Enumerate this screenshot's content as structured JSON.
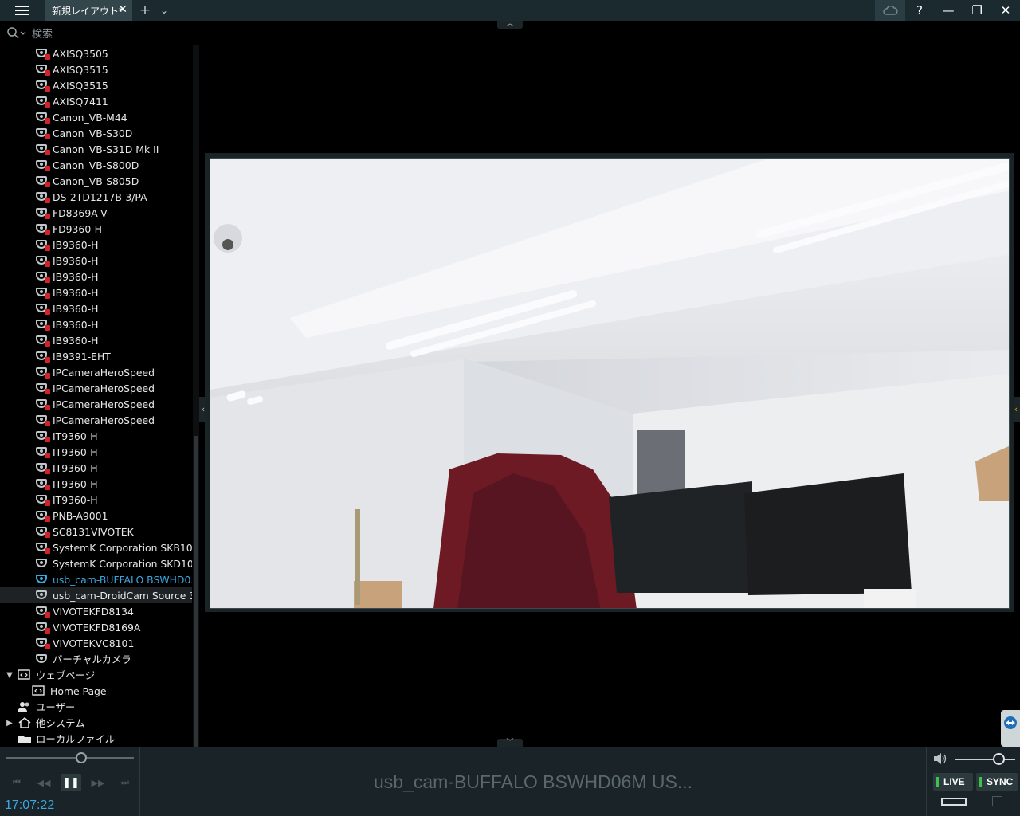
{
  "titlebar": {
    "tab_label": "新規レイアウト*",
    "tab_close": "✕",
    "add_tab": "+",
    "tab_menu": "⌄",
    "help": "?",
    "minimize": "—",
    "restore": "❐",
    "close": "✕"
  },
  "search": {
    "placeholder": "検索"
  },
  "cameras": [
    {
      "label": "AXISQ3505",
      "status": "locked"
    },
    {
      "label": "AXISQ3515",
      "status": "error"
    },
    {
      "label": "AXISQ3515",
      "status": "locked"
    },
    {
      "label": "AXISQ7411",
      "status": "locked"
    },
    {
      "label": "Canon_VB-M44",
      "status": "locked"
    },
    {
      "label": "Canon_VB-S30D",
      "status": "locked"
    },
    {
      "label": "Canon_VB-S31D Mk II",
      "status": "locked"
    },
    {
      "label": "Canon_VB-S800D",
      "status": "locked"
    },
    {
      "label": "Canon_VB-S805D",
      "status": "locked"
    },
    {
      "label": "DS-2TD1217B-3/PA",
      "status": "locked"
    },
    {
      "label": "FD8369A-V",
      "status": "locked"
    },
    {
      "label": "FD9360-H",
      "status": "locked"
    },
    {
      "label": "IB9360-H",
      "status": "locked"
    },
    {
      "label": "IB9360-H",
      "status": "locked"
    },
    {
      "label": "IB9360-H",
      "status": "locked"
    },
    {
      "label": "IB9360-H",
      "status": "locked"
    },
    {
      "label": "IB9360-H",
      "status": "locked"
    },
    {
      "label": "IB9360-H",
      "status": "locked"
    },
    {
      "label": "IB9360-H",
      "status": "locked"
    },
    {
      "label": "IB9391-EHT",
      "status": "locked"
    },
    {
      "label": "IPCameraHeroSpeed",
      "status": "error"
    },
    {
      "label": "IPCameraHeroSpeed",
      "status": "error"
    },
    {
      "label": "IPCameraHeroSpeed",
      "status": "error"
    },
    {
      "label": "IPCameraHeroSpeed",
      "status": "error"
    },
    {
      "label": "IT9360-H",
      "status": "locked"
    },
    {
      "label": "IT9360-H",
      "status": "locked"
    },
    {
      "label": "IT9360-H",
      "status": "locked"
    },
    {
      "label": "IT9360-H",
      "status": "locked"
    },
    {
      "label": "IT9360-H",
      "status": "locked"
    },
    {
      "label": "PNB-A9001",
      "status": "locked"
    },
    {
      "label": "SC8131VIVOTEK",
      "status": "locked"
    },
    {
      "label": "SystemK Corporation SKB10",
      "status": "error"
    },
    {
      "label": "SystemK Corporation SKD10",
      "status": "online"
    },
    {
      "label": "usb_cam-BUFFALO BSWHD0...",
      "status": "selected"
    },
    {
      "label": "usb_cam-DroidCam Source 3",
      "status": "online"
    },
    {
      "label": "VIVOTEKFD8134",
      "status": "locked"
    },
    {
      "label": "VIVOTEKFD8169A",
      "status": "locked"
    },
    {
      "label": "VIVOTEKVC8101",
      "status": "locked"
    },
    {
      "label": "バーチャルカメラ",
      "status": "virtual"
    }
  ],
  "groups": {
    "webpages": "ウェブページ",
    "home_page": "Home Page",
    "users": "ユーザー",
    "other_systems": "他システム",
    "local_files": "ローカルファイル"
  },
  "playback": {
    "clock": "17:07:22",
    "pause": "❚❚",
    "skip_start": "⏮",
    "rewind": "◀◀",
    "forward": "▶▶",
    "skip_end": "⏭"
  },
  "current_item_title": "usb_cam-BUFFALO BSWHD06M US...",
  "right_controls": {
    "live_label": "LIVE",
    "sync_label": "SYNC"
  },
  "colors": {
    "accent_blue": "#3aa7e0",
    "lock_red": "#d2232a",
    "led_green": "#39c54b",
    "nav_orange": "#e3a20e"
  }
}
